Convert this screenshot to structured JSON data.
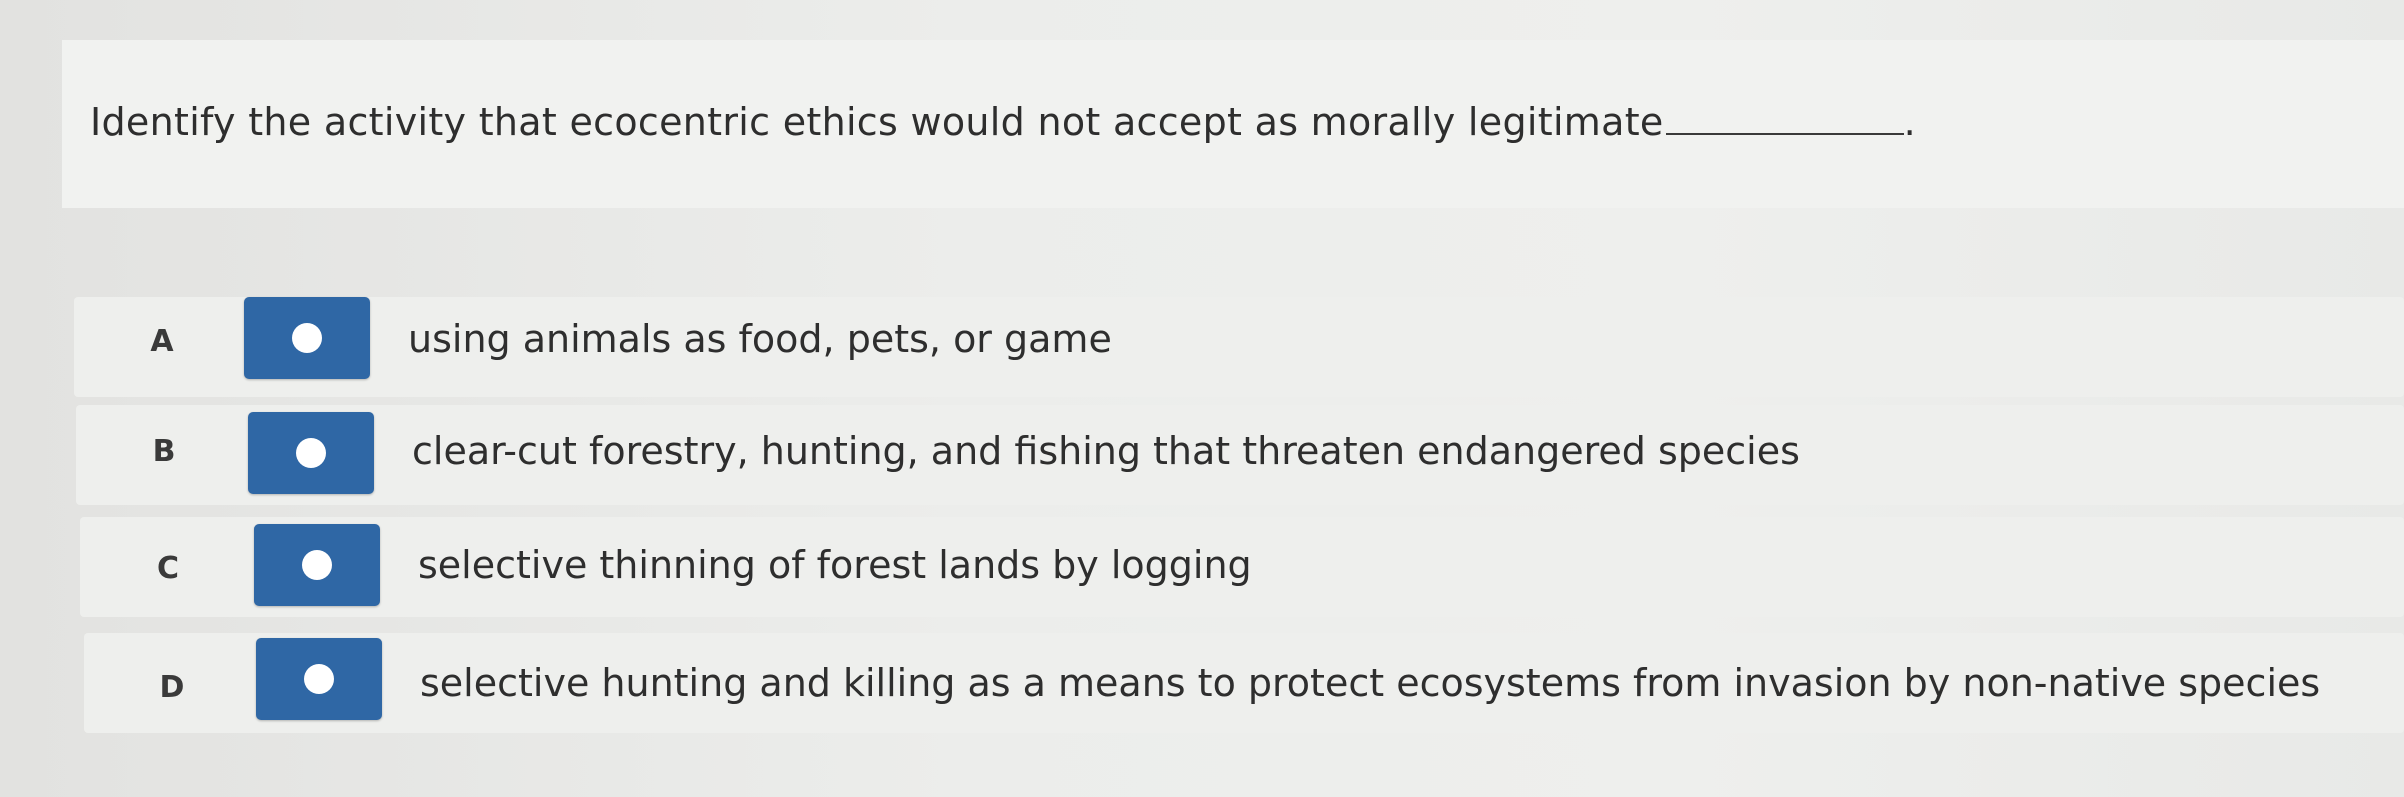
{
  "question": {
    "text": "Identify the activity that ecocentric ethics would not accept as morally legitimate",
    "end_punctuation": "."
  },
  "answers": [
    {
      "letter": "A",
      "text": "using animals as food, pets, or game"
    },
    {
      "letter": "B",
      "text": "clear-cut forestry, hunting, and fishing that threaten endangered species"
    },
    {
      "letter": "C",
      "text": "selective thinning of forest lands by logging"
    },
    {
      "letter": "D",
      "text": "selective hunting and killing as a means to protect ecosystems from invasion by non-native species"
    }
  ],
  "colors": {
    "radio_button": "#2f67a5",
    "radio_dot": "#ffffff",
    "background": "#eeefed"
  },
  "icons": {
    "radio": "radio-circle-icon"
  }
}
